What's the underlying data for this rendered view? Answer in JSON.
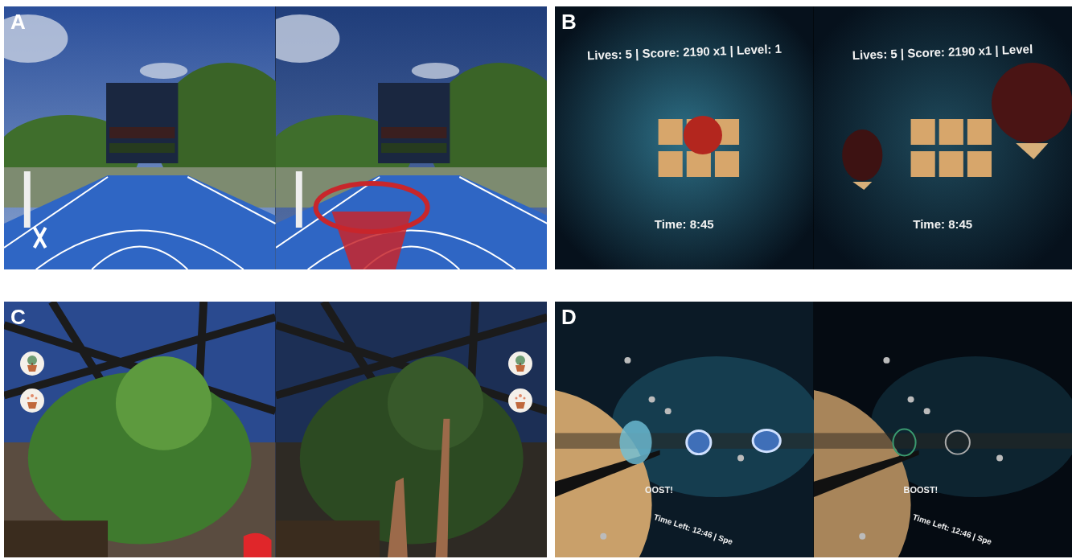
{
  "panels": [
    {
      "label": "A",
      "frames": [
        {
          "kind": "court"
        },
        {
          "kind": "court-hoop"
        }
      ]
    },
    {
      "label": "B",
      "frames": [
        {
          "kind": "space-ball",
          "hud": [
            {
              "kind": "top",
              "text": "Lives: 5 | Score: 2190 x1 | Level: 1"
            },
            {
              "kind": "bottom",
              "text": "Time: 8:45"
            }
          ]
        },
        {
          "kind": "space-paddles",
          "hud": [
            {
              "kind": "top",
              "text": "Lives: 5 | Score: 2190 x1 | Level"
            },
            {
              "kind": "bottom",
              "text": "Time: 8:45"
            }
          ]
        }
      ]
    },
    {
      "label": "C",
      "frames": [
        {
          "kind": "greenhouse"
        },
        {
          "kind": "greenhouse-hands"
        }
      ]
    },
    {
      "label": "D",
      "frames": [
        {
          "kind": "planet-ship",
          "hud": [
            {
              "kind": "boost",
              "text": "OOST!"
            },
            {
              "kind": "tilted",
              "text": "Time Left: 12:46 | Spe"
            }
          ]
        },
        {
          "kind": "planet-dim",
          "hud": [
            {
              "kind": "boost",
              "text": "BOOST!"
            },
            {
              "kind": "tilted",
              "text": "Time Left: 12:46 | Spe"
            }
          ]
        }
      ]
    }
  ]
}
